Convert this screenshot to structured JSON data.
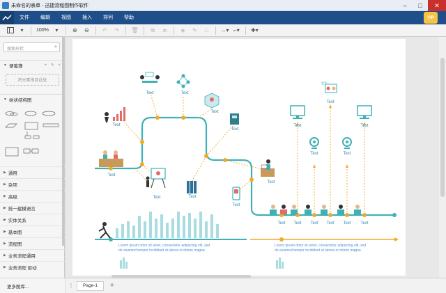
{
  "window": {
    "title": "未命名的表单 - 迅捷流程图制作软件",
    "minimize": "–",
    "maximize": "□",
    "close": "✕"
  },
  "menu": {
    "items": [
      "文件",
      "编辑",
      "视图",
      "插入",
      "排列",
      "帮助"
    ],
    "vip": "VIP"
  },
  "toolbar": {
    "zoom": "100%"
  },
  "sidebar": {
    "search_placeholder": "搜索形状",
    "scratchpad_title": "便笺簿",
    "scratchpad_actions": "+ ✎ ×",
    "drop_hint": "将元素拖到此处",
    "tree_section_title": "树状结构图",
    "libraries": [
      "通用",
      "杂项",
      "高级",
      "统一建模语言",
      "实体关系",
      "基本图",
      "流程图",
      "业务流程通用",
      "业务流程 驱动"
    ],
    "more_libraries": "更多图库..."
  },
  "pages": {
    "tab_label": "Page-1"
  },
  "diagram": {
    "node_label": "Text",
    "paragraph_line1": "Lorem ipsum dolor sit amet, consectetur adipiscing elit, sed",
    "paragraph_line2": "do eiusmod tempor incididunt ut labore et dolore magna",
    "colors": {
      "teal": "#3fb1b5",
      "orange": "#f3a928",
      "bar": "#a8dce0",
      "text_teal": "#2f8aa8",
      "lorem": "#4a90d9"
    }
  }
}
